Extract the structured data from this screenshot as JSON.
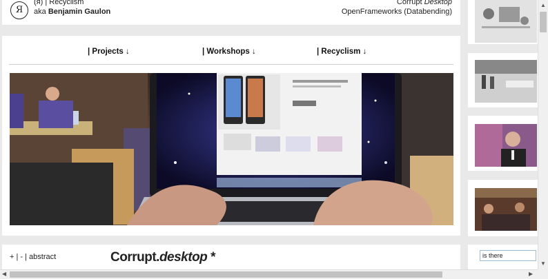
{
  "header": {
    "logo_glyph": "Я",
    "left_line1": "(я) | Recyclism",
    "left_line2_prefix": "aka",
    "left_line2_name": "Benjamin Gaulon",
    "right_line1_prefix": "Corrupt",
    "right_line1_emph": "Desktop",
    "right_line2": "OpenFrameworks (Databending)"
  },
  "nav": {
    "projects": "| Projects ↓",
    "workshops": "| Workshops ↓",
    "recyclism": "| Recyclism ↓"
  },
  "hero": {
    "description": "photo of hands typing on a laptop showing corrupted desktop"
  },
  "bottom": {
    "nav_text": "+ | - | abstract",
    "title_prefix": "Corrupt.",
    "title_emph": "desktop",
    "title_suffix": " *"
  },
  "sidebar": {
    "search_value": "is there"
  },
  "colors": {
    "background": "#e9e9e9",
    "card": "#ffffff",
    "text": "#222222"
  }
}
